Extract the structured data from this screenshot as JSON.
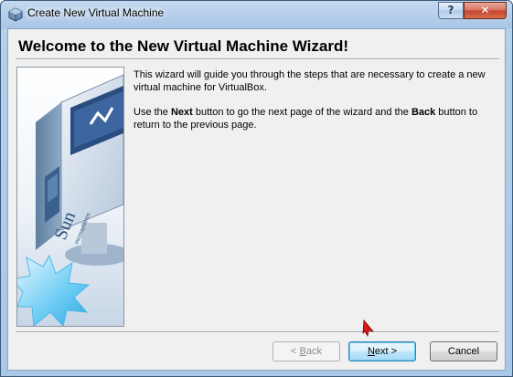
{
  "window": {
    "title": "Create New Virtual Machine",
    "help_label": "?",
    "close_label": "✕"
  },
  "wizard": {
    "heading": "Welcome to the New Virtual Machine Wizard!",
    "paragraph1": "This wizard will guide you through the steps that are necessary to create a new virtual machine for VirtualBox.",
    "p2_pre": "Use the ",
    "p2_next": "Next",
    "p2_mid": " button to go the next page of the wizard and the ",
    "p2_back": "Back",
    "p2_post": " button to return to the previous page."
  },
  "buttons": {
    "back": {
      "prefix": "< ",
      "mnemonic": "B",
      "rest": "ack",
      "enabled": false
    },
    "next": {
      "mnemonic": "N",
      "rest": "ext >",
      "enabled": true
    },
    "cancel": {
      "label": "Cancel",
      "enabled": true
    }
  },
  "image": {
    "logo_text": "Sun",
    "logo_subtext": "microsystems"
  }
}
